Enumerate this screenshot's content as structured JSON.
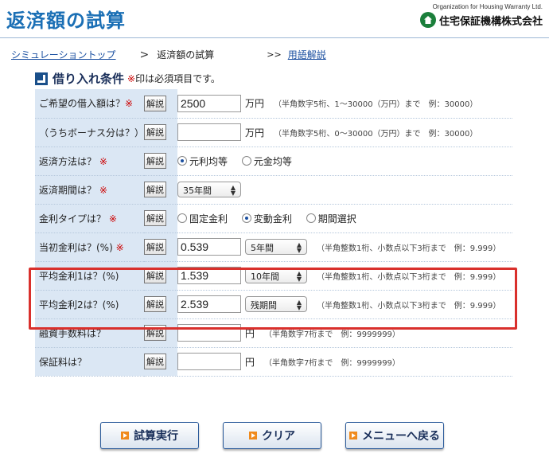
{
  "header": {
    "title": "返済額の試算",
    "org_en": "Organization for Housing Warranty Ltd.",
    "org_ja": "住宅保証機構株式会社",
    "accent": "#1a6fb5"
  },
  "breadcrumb": {
    "top_link": "シミュレーショントップ",
    "separator": ">",
    "current": "返済額の試算",
    "glossary_prefix": ">>",
    "glossary_link": "用語解説"
  },
  "section": {
    "title": "借り入れ条件",
    "req_mark": "※",
    "note": "印は必須項目です。"
  },
  "help_label": "解説",
  "required_mark": "※",
  "rows": {
    "loan_amount": {
      "label": "ご希望の借入額は？",
      "value": "2500",
      "unit": "万円",
      "hint": "（半角数字5桁、1〜30000（万円）まで　例：30000）"
    },
    "bonus": {
      "label": "（うちボーナス分は？）",
      "value": "",
      "unit": "万円",
      "hint": "（半角数字5桁、0〜30000（万円）まで　例：30000）"
    },
    "repay_method": {
      "label": "返済方法は？",
      "options": [
        "元利均等",
        "元金均等"
      ],
      "selected": "元利均等"
    },
    "repay_period": {
      "label": "返済期間は？",
      "selected": "35年間"
    },
    "rate_type": {
      "label": "金利タイプは？",
      "options": [
        "固定金利",
        "変動金利",
        "期間選択"
      ],
      "selected": "変動金利"
    },
    "initial_rate": {
      "label": "当初金利は？(%)",
      "value": "0.539",
      "period": "5年間",
      "hint": "（半角整数1桁、小数点以下3桁まで　例：9.999）"
    },
    "avg_rate1": {
      "label": "平均金利1は？(%)",
      "value": "1.539",
      "period": "10年間",
      "hint": "（半角整数1桁、小数点以下3桁まで　例：9.999）"
    },
    "avg_rate2": {
      "label": "平均金利2は？(%)",
      "value": "2.539",
      "period": "残期間",
      "hint": "（半角整数1桁、小数点以下3桁まで　例：9.999）"
    },
    "loan_fee": {
      "label": "融資手数料は？",
      "value": "",
      "unit": "円",
      "hint": "（半角数字7桁まで　例：9999999）"
    },
    "guarantee_fee": {
      "label": "保証料は？",
      "value": "",
      "unit": "円",
      "hint": "（半角数字7桁まで　例：9999999）"
    }
  },
  "buttons": {
    "calculate": "試算実行",
    "clear": "クリア",
    "menu": "メニューへ戻る"
  },
  "colors": {
    "label_bg": "#dbe7f4",
    "highlight_border": "#d9302c",
    "button_mark": "#f08a1c"
  }
}
